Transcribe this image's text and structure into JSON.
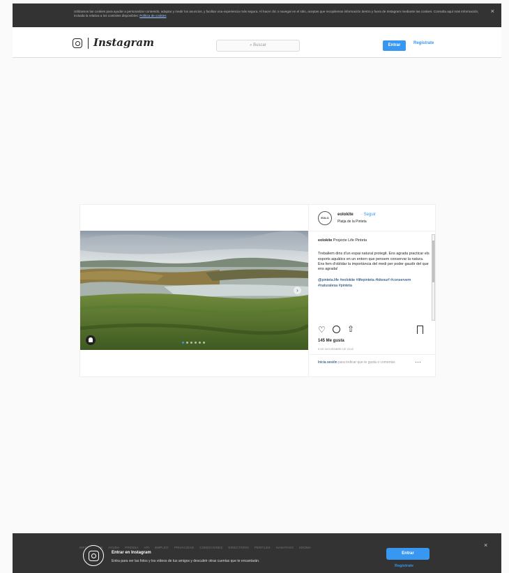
{
  "cookie_banner": {
    "text": "Utilizamos las cookies para ayudar a personalizar contenido, adaptar y medir los anuncios, y facilitar una experiencia más segura. Al hacer clic o navegar en el sitio, aceptas que recopilemos información dentro y fuera de Instagram mediante las cookies. Consulta aquí más información, incluida la relativa a los controles disponibles: ",
    "link": "Política de cookies",
    "close": "×"
  },
  "header": {
    "logo": "Instagram",
    "search_placeholder": "Buscar",
    "search_icon": "search-icon",
    "login": "Entrar",
    "register": "Regístrate"
  },
  "post": {
    "username": "eolokite",
    "follow": "Seguir",
    "location": "Platja de la Pinteta",
    "caption_user": "eolokite",
    "caption_title": "Projecte Life Pinteta",
    "caption_body": "Trebaliem dins d'un espai natural protegit. Ens agrada practicar els esports aquàtics en un entorn que pensem conservar la natura. Ens fem d'oblidar la importància del medi per poder gaudir del que ens agrada!",
    "hashtags": "@pinteta.life #eolokite #lifepinteta #kitesurf #conservem #naturalesa #pinteta",
    "likes": "145 Me gusta",
    "date": "5 DE NOVIEMBRE DE 2018",
    "comment_login": "Inicia sesión",
    "comment_rest": " para indicar que te gusta o comentar.",
    "more": "···",
    "slides": 6,
    "active_slide": 1
  },
  "bottom_bar": {
    "footer_links": [
      "INFORMACIÓN",
      "AYUDA",
      "PRENSA",
      "API",
      "EMPLEO",
      "PRIVACIDAD",
      "CONDICIONES",
      "DIRECTORIO",
      "PERFILES",
      "HASHTAGS",
      "IDIOMA"
    ],
    "title": "Entrar en Instagram",
    "subtitle": "Entra para ver las fotos y los vídeos de tus amigos y descubrir otras cuentas que te encantarán.",
    "login": "Entrar",
    "register": "Regístrate",
    "close": "×"
  }
}
